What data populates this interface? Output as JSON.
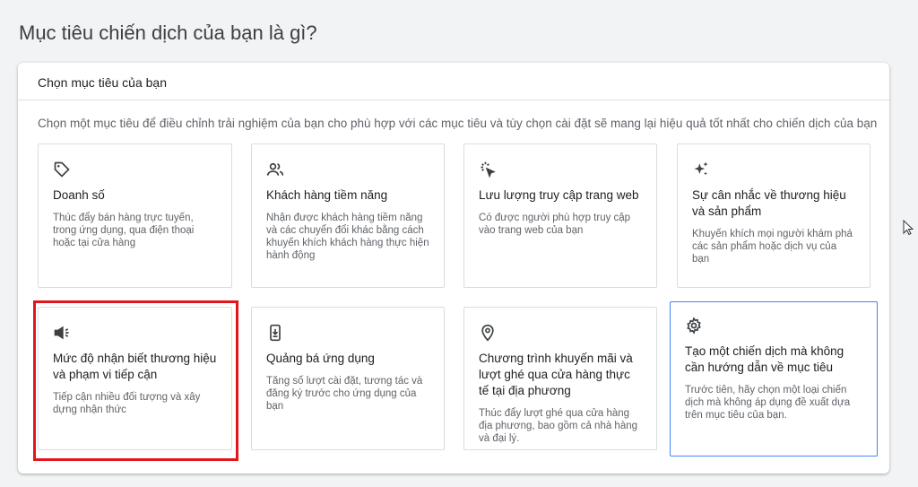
{
  "page": {
    "title": "Mục tiêu chiến dịch của bạn là gì?"
  },
  "panel": {
    "header": "Chọn mục tiêu của bạn",
    "description": "Chọn một mục tiêu để điều chỉnh trải nghiệm của bạn cho phù hợp với các mục tiêu và tùy chọn cài đặt sẽ mang lại hiệu quả tốt nhất cho chiến dịch của bạn"
  },
  "cards": [
    {
      "icon": "tag-icon",
      "title": "Doanh số",
      "description": "Thúc đẩy bán hàng trực tuyến, trong ứng dụng, qua điện thoại hoặc tại cửa hàng"
    },
    {
      "icon": "people-icon",
      "title": "Khách hàng tiềm năng",
      "description": "Nhận được khách hàng tiềm năng và các chuyển đổi khác bằng cách khuyến khích khách hàng thực hiện hành động"
    },
    {
      "icon": "cursor-click-icon",
      "title": "Lưu lượng truy cập trang web",
      "description": "Có được người phù hợp truy cập vào trang web của bạn"
    },
    {
      "icon": "sparkle-icon",
      "title": "Sự cân nhắc về thương hiệu và sản phẩm",
      "description": "Khuyến khích mọi người khám phá các sản phẩm hoặc dịch vụ của bạn"
    },
    {
      "icon": "megaphone-icon",
      "title": "Mức độ nhận biết thương hiệu và phạm vi tiếp cận",
      "description": "Tiếp cận nhiều đối tượng và xây dựng nhận thức"
    },
    {
      "icon": "phone-download-icon",
      "title": "Quảng bá ứng dụng",
      "description": "Tăng số lượt cài đặt, tương tác và đăng ký trước cho ứng dụng của bạn"
    },
    {
      "icon": "location-pin-icon",
      "title": "Chương trình khuyến mãi và lượt ghé qua cửa hàng thực tế tại địa phương",
      "description": "Thúc đẩy lượt ghé qua cửa hàng địa phương, bao gồm cả nhà hàng và đại lý."
    },
    {
      "icon": "gear-icon",
      "title": "Tạo một chiến dịch mà không cần hướng dẫn về mục tiêu",
      "description": "Trước tiên, hãy chọn một loại chiến dịch mà không áp dụng đề xuất dựa trên mục tiêu của bạn."
    }
  ],
  "colors": {
    "selected_border": "#4285f4",
    "highlight_box": "#e3141c",
    "background": "#f1f3f4"
  }
}
